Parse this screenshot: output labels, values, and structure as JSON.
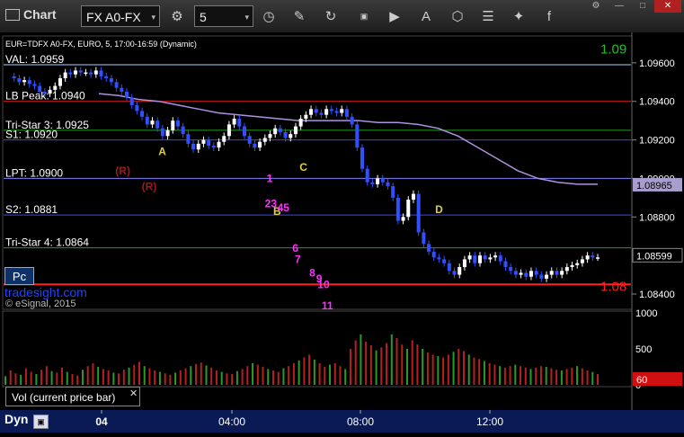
{
  "toolbar": {
    "title": "Chart",
    "symbol": "FX A0-FX",
    "interval": "5",
    "icons": [
      "settings-icon",
      "clock-icon",
      "pencil-icon",
      "refresh-icon",
      "get-icon",
      "play-icon",
      "font-icon",
      "network-icon",
      "notes-icon",
      "twitter-icon",
      "facebook-icon"
    ]
  },
  "chart_header": "EUR=TDFX A0-FX, EURO, 5, 17:00-16:59 (Dynamic)",
  "brand": "tradesight.com",
  "copyright": "© eSignal, 2015",
  "pc_label": "Pc",
  "volume_legend": "Vol (current price bar)",
  "bottom": {
    "dyn": "Dyn",
    "x_ticks": [
      "04",
      "04:00",
      "08:00",
      "12:00"
    ]
  },
  "colors": {
    "up_bar": "#ffffff",
    "down_bar": "#3050ff",
    "ma_line": "#b090e0",
    "green_line": "#20a020",
    "red_line": "#e02020",
    "blue_line": "#4040ff"
  },
  "chart_data": {
    "type": "line",
    "price_axis": {
      "ticks": [
        "1.09600",
        "1.09400",
        "1.09200",
        "1.09000",
        "1.08800",
        "1.08400"
      ],
      "range": [
        1.0833,
        1.0973
      ]
    },
    "levels": [
      {
        "name": "VAL: 1.0959",
        "value": 1.0959,
        "color": "#9fd0ff"
      },
      {
        "name": "LB Peak: 1.0940",
        "value": 1.094,
        "color": "#e02020"
      },
      {
        "name": "Tri-Star 3: 1.0925",
        "value": 1.0925,
        "color": "#20a020"
      },
      {
        "name": "S1: 1.0920",
        "value": 1.092,
        "color": "#4040ff"
      },
      {
        "name": "LPT: 1.0900",
        "value": 1.09,
        "color": "#8080ff"
      },
      {
        "name": "S2: 1.0881",
        "value": 1.0881,
        "color": "#4040ff"
      },
      {
        "name": "Tri-Star 4: 1.0864",
        "value": 1.0864,
        "color": "#20a020"
      },
      {
        "name": "",
        "value": 1.0845,
        "color": "#ff2020"
      }
    ],
    "edge_labels": [
      {
        "text": "1.09",
        "value": 1.0968,
        "color": "#20c020"
      },
      {
        "text": "1.08",
        "value": 1.0845,
        "color": "#ff2020"
      }
    ],
    "price_tags": [
      {
        "text": "1.08965",
        "value": 1.08965,
        "bg": "#a99ccf",
        "color": "#000"
      },
      {
        "text": "1.08599",
        "value": 1.08599,
        "bg": "#000",
        "color": "#fff"
      }
    ],
    "price_series": [
      1.0953,
      1.0952,
      1.095,
      1.0951,
      1.0949,
      1.0948,
      1.0945,
      1.0944,
      1.0946,
      1.0948,
      1.0952,
      1.0955,
      1.0954,
      1.0956,
      1.0955,
      1.0955,
      1.0954,
      1.0956,
      1.0953,
      1.0952,
      1.095,
      1.0947,
      1.0945,
      1.0942,
      1.0938,
      1.0935,
      1.0932,
      1.0928,
      1.093,
      1.0926,
      1.0922,
      1.0925,
      1.093,
      1.0927,
      1.0923,
      1.0918,
      1.0915,
      1.0918,
      1.092,
      1.0917,
      1.0916,
      1.0919,
      1.0922,
      1.0928,
      1.0931,
      1.0927,
      1.0922,
      1.0918,
      1.0916,
      1.0919,
      1.0921,
      1.0923,
      1.0926,
      1.0924,
      1.0921,
      1.0923,
      1.0927,
      1.0931,
      1.0933,
      1.0936,
      1.0934,
      1.0933,
      1.0936,
      1.0935,
      1.0934,
      1.0936,
      1.0932,
      1.0928,
      1.0916,
      1.0905,
      1.0898,
      1.0897,
      1.09,
      1.0898,
      1.0896,
      1.089,
      1.0878,
      1.088,
      1.0889,
      1.0892,
      1.0872,
      1.0866,
      1.0862,
      1.0859,
      1.0858,
      1.0856,
      1.0852,
      1.085,
      1.0854,
      1.0858,
      1.086,
      1.0856,
      1.086,
      1.0858,
      1.0859,
      1.086,
      1.0857,
      1.0854,
      1.0852,
      1.085,
      1.0851,
      1.0849,
      1.0852,
      1.085,
      1.0848,
      1.085,
      1.0852,
      1.085,
      1.0852,
      1.0854,
      1.0855,
      1.0856,
      1.0858,
      1.086,
      1.0859,
      1.0859
    ],
    "ma_series": [
      1.0944,
      1.0943,
      1.0941,
      1.094,
      1.0938,
      1.0936,
      1.0934,
      1.0933,
      1.0932,
      1.0931,
      1.093,
      1.093,
      1.093,
      1.093,
      1.0929,
      1.0929,
      1.0928,
      1.0926,
      1.0922,
      1.0916,
      1.091,
      1.0904,
      1.09,
      1.0898,
      1.0897,
      1.0897
    ],
    "annotations": [
      {
        "text": "A",
        "color": "#e0d040",
        "x": 0.253,
        "y": 1.0912
      },
      {
        "text": "(R)",
        "color": "#a01818",
        "x": 0.19,
        "y": 1.0902
      },
      {
        "text": "(R)",
        "color": "#a01818",
        "x": 0.232,
        "y": 1.0894
      },
      {
        "text": "C",
        "color": "#e0d040",
        "x": 0.478,
        "y": 1.0904
      },
      {
        "text": "B",
        "color": "#e0d040",
        "x": 0.436,
        "y": 1.0881
      },
      {
        "text": "D",
        "color": "#e0d040",
        "x": 0.694,
        "y": 1.0882
      },
      {
        "text": "1",
        "color": "#ff30ff",
        "x": 0.424,
        "y": 1.0898
      },
      {
        "text": "23",
        "color": "#ff30ff",
        "x": 0.426,
        "y": 1.0885
      },
      {
        "text": "45",
        "color": "#ff30ff",
        "x": 0.446,
        "y": 1.0883
      },
      {
        "text": "6",
        "color": "#ff30ff",
        "x": 0.465,
        "y": 1.0862
      },
      {
        "text": "7",
        "color": "#ff30ff",
        "x": 0.469,
        "y": 1.0856
      },
      {
        "text": "8",
        "color": "#ff30ff",
        "x": 0.492,
        "y": 1.0849
      },
      {
        "text": "9",
        "color": "#ff30ff",
        "x": 0.503,
        "y": 1.0846
      },
      {
        "text": "10",
        "color": "#ff30ff",
        "x": 0.51,
        "y": 1.0843
      },
      {
        "text": "11",
        "color": "#ff30ff",
        "x": 0.516,
        "y": 1.0832
      }
    ],
    "volume_axis": {
      "ticks": [
        "1000",
        "500",
        "0"
      ],
      "range": [
        0,
        1000
      ]
    },
    "volume_tag": "60",
    "volume": [
      120,
      200,
      160,
      140,
      230,
      180,
      150,
      210,
      260,
      190,
      170,
      240,
      180,
      150,
      130,
      210,
      260,
      300,
      250,
      220,
      200,
      170,
      160,
      210,
      240,
      280,
      320,
      260,
      230,
      200,
      180,
      160,
      140,
      170,
      200,
      230,
      260,
      290,
      310,
      270,
      240,
      200,
      180,
      160,
      150,
      190,
      220,
      260,
      300,
      280,
      250,
      220,
      200,
      180,
      230,
      260,
      300,
      340,
      380,
      420,
      350,
      300,
      250,
      280,
      300,
      260,
      220,
      500,
      620,
      700,
      600,
      550,
      480,
      520,
      580,
      700,
      650,
      560,
      500,
      620,
      560,
      500,
      450,
      420,
      400,
      380,
      420,
      460,
      500,
      470,
      420,
      380,
      360,
      330,
      300,
      280,
      260,
      240,
      260,
      280,
      260,
      240,
      220,
      240,
      260,
      250,
      230,
      210,
      200,
      220,
      240,
      260,
      230,
      200,
      180,
      150
    ]
  }
}
